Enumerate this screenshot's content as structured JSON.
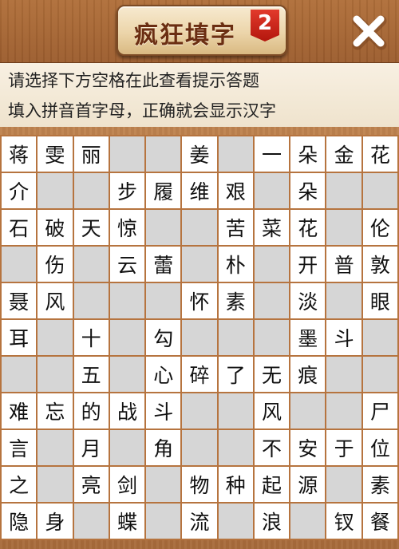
{
  "header": {
    "title": "疯狂填字",
    "badge": "2"
  },
  "icons": {
    "close": "close-icon"
  },
  "hints": {
    "line1": "请选择下方空格在此查看提示答题",
    "line2": "填入拼音首字母，正确就会显示汉字"
  },
  "colors": {
    "wood": "#b97b47",
    "cell_filled": "#ffffff",
    "cell_empty": "#d6d6d6",
    "badge_red": "#c8261a"
  },
  "grid": {
    "rows": 11,
    "cols": 11,
    "cells": [
      [
        "蒋",
        "雯",
        "丽",
        "",
        "",
        "姜",
        "",
        "一",
        "朵",
        "金",
        "花"
      ],
      [
        "介",
        "",
        "",
        "步",
        "履",
        "维",
        "艰",
        "",
        "朵",
        "",
        ""
      ],
      [
        "石",
        "破",
        "天",
        "惊",
        "",
        "",
        "苦",
        "菜",
        "花",
        "",
        "伦"
      ],
      [
        "",
        "伤",
        "",
        "云",
        "蕾",
        "",
        "朴",
        "",
        "开",
        "普",
        "敦"
      ],
      [
        "聂",
        "风",
        "",
        "",
        "",
        "怀",
        "素",
        "",
        "淡",
        "",
        "眼"
      ],
      [
        "耳",
        "",
        "十",
        "",
        "勾",
        "",
        "",
        "",
        "墨",
        "斗",
        ""
      ],
      [
        "",
        "",
        "五",
        "",
        "心",
        "碎",
        "了",
        "无",
        "痕",
        "",
        ""
      ],
      [
        "难",
        "忘",
        "的",
        "战",
        "斗",
        "",
        "",
        "风",
        "",
        "",
        "尸"
      ],
      [
        "言",
        "",
        "月",
        "",
        "角",
        "",
        "",
        "不",
        "安",
        "于",
        "位"
      ],
      [
        "之",
        "",
        "亮",
        "剑",
        "",
        "物",
        "种",
        "起",
        "源",
        "",
        "素"
      ],
      [
        "隐",
        "身",
        "",
        "蝶",
        "",
        "流",
        "",
        "浪",
        "",
        "钗",
        "餐"
      ]
    ]
  }
}
